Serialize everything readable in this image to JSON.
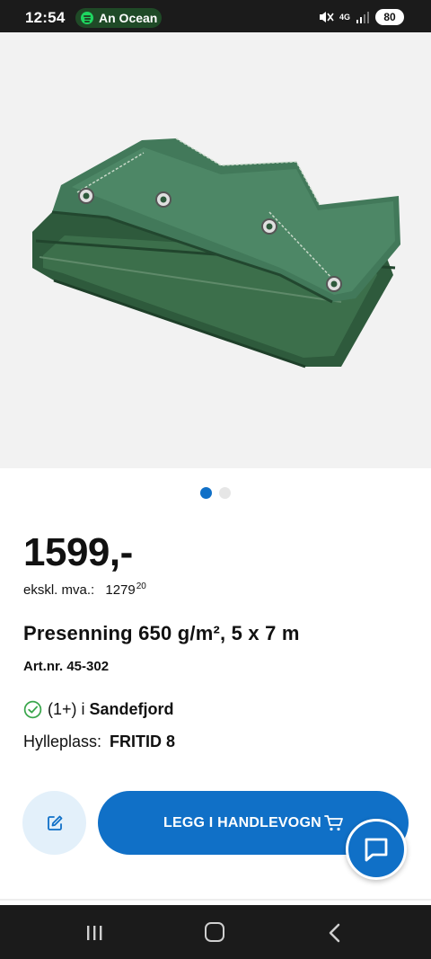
{
  "status_bar": {
    "time": "12:54",
    "media_text": "An Ocean",
    "network": "4G",
    "battery": "80"
  },
  "product": {
    "image_icon": "folded-green-tarpaulin-image",
    "carousel": {
      "total": 2,
      "active_index": 0
    },
    "price": "1599,-",
    "ex_vat_label": "ekskl. mva.:",
    "ex_vat_value": "1279",
    "ex_vat_cents": "20",
    "title": "Presenning 650 g/m², 5 x 7 m",
    "article_number": "Art.nr. 45-302",
    "stock_count": "(1+) i",
    "stock_store": "Sandefjord",
    "shelf_label": "Hylleplass:",
    "shelf_value": "FRITID 8"
  },
  "actions": {
    "edit_icon": "edit-note-icon",
    "add_to_cart_label": "LEGG I HANDLEVOGN",
    "cart_icon": "cart-icon",
    "chat_icon": "chat-icon"
  },
  "colors": {
    "accent": "#1070c7",
    "accent_light": "#e3f0fa",
    "stock_ok": "#3aa64c"
  }
}
